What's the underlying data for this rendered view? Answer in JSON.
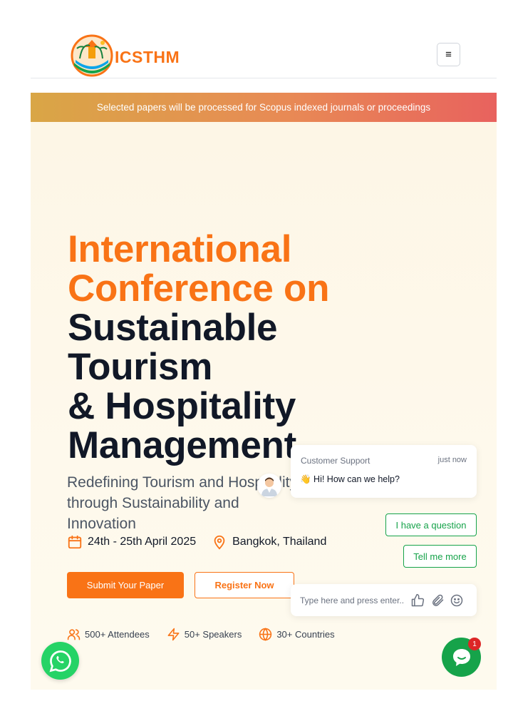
{
  "header": {
    "logo_text": "ICSTHM",
    "menu_icon": "≡"
  },
  "banner": {
    "text": "Selected papers will be processed for Scopus indexed journals or proceedings"
  },
  "hero": {
    "title_lines_orange": [
      "International",
      "Conference on"
    ],
    "title_lines_dark": [
      "Sustainable",
      "Tourism",
      "& Hospitality",
      "Management"
    ],
    "subtitle": "Redefining Tourism and Hospitality through Sustainability and Innovation",
    "date": "24th - 25th April  2025",
    "location": "Bangkok, Thailand",
    "submit_label": "Submit Your Paper",
    "register_label": "Register Now",
    "stats": [
      {
        "label": "500+ Attendees",
        "icon": "users-icon"
      },
      {
        "label": "50+ Speakers",
        "icon": "lightning-icon"
      },
      {
        "label": "30+ Countries",
        "icon": "globe-icon"
      }
    ]
  },
  "chat": {
    "header": "Customer Support",
    "time": "just now",
    "message": "👋 Hi! How can we help?",
    "quick_replies": [
      "I have a question",
      "Tell me more"
    ],
    "input_placeholder": "Type here and press enter..",
    "badge_count": "1"
  },
  "colors": {
    "accent": "#f97316",
    "dark": "#111827",
    "chat_green": "#16a34a",
    "whatsapp": "#25d366"
  }
}
